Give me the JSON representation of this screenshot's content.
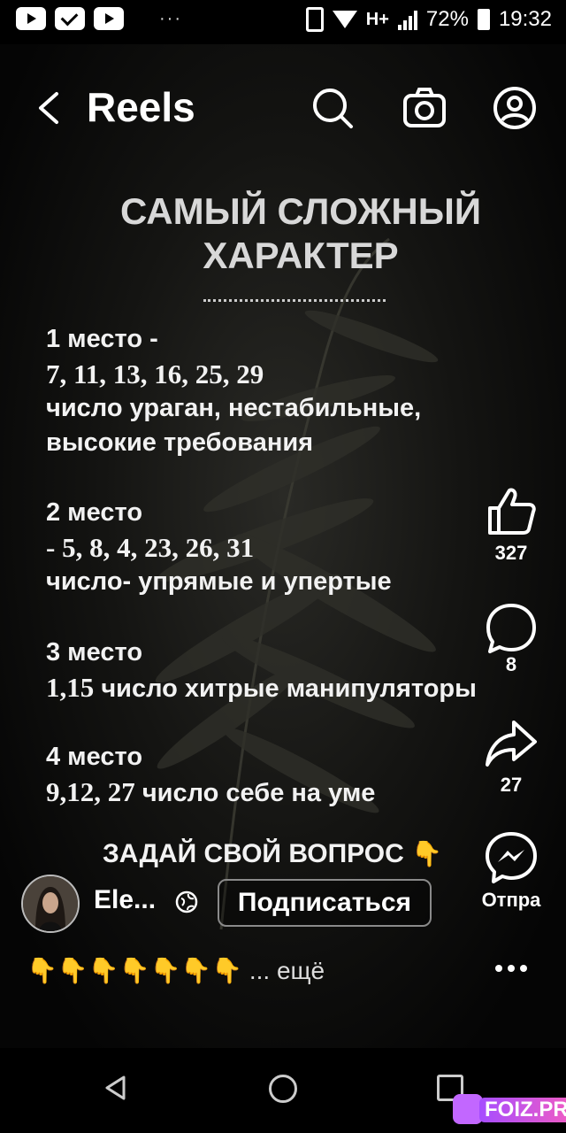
{
  "status_bar": {
    "battery": "72%",
    "time": "19:32",
    "network": "H+",
    "more": "···"
  },
  "header": {
    "title": "Reels"
  },
  "reel": {
    "title_line1": "САМЫЙ СЛОЖНЫЙ",
    "title_line2": "ХАРАКТЕР",
    "places": [
      {
        "heading": "1 место -",
        "numbers": "7, 11, 13, 16, 25, 29",
        "desc1": "число ураган, нестабильные,",
        "desc2": "высокие требования"
      },
      {
        "heading": "2 место",
        "numbers": "- 5, 8, 4, 23, 26, 31",
        "desc1": "число- упрямые и упертые"
      },
      {
        "heading": "3 место",
        "numbers": "1,15",
        "desc1": "число хитрые манипуляторы"
      },
      {
        "heading": "4 место",
        "numbers": "9,12, 27",
        "desc1": "число себе на уме"
      }
    ],
    "cta": "ЗАДАЙ СВОЙ ВОПРОС",
    "cta_emoji": "👇"
  },
  "actions": {
    "likes": "327",
    "comments": "8",
    "shares": "27",
    "send_label": "Отпра"
  },
  "author": {
    "name": "Ele...",
    "follow_label": "Подписаться"
  },
  "caption": {
    "emojis": "👇👇👇👇👇👇👇",
    "more": "... ещё"
  },
  "watermark": "FOIZ.PRO",
  "colors": {
    "background": "#000000",
    "text": "#ffffff",
    "title_text": "#d8d8d8",
    "watermark": "#c267ff"
  }
}
